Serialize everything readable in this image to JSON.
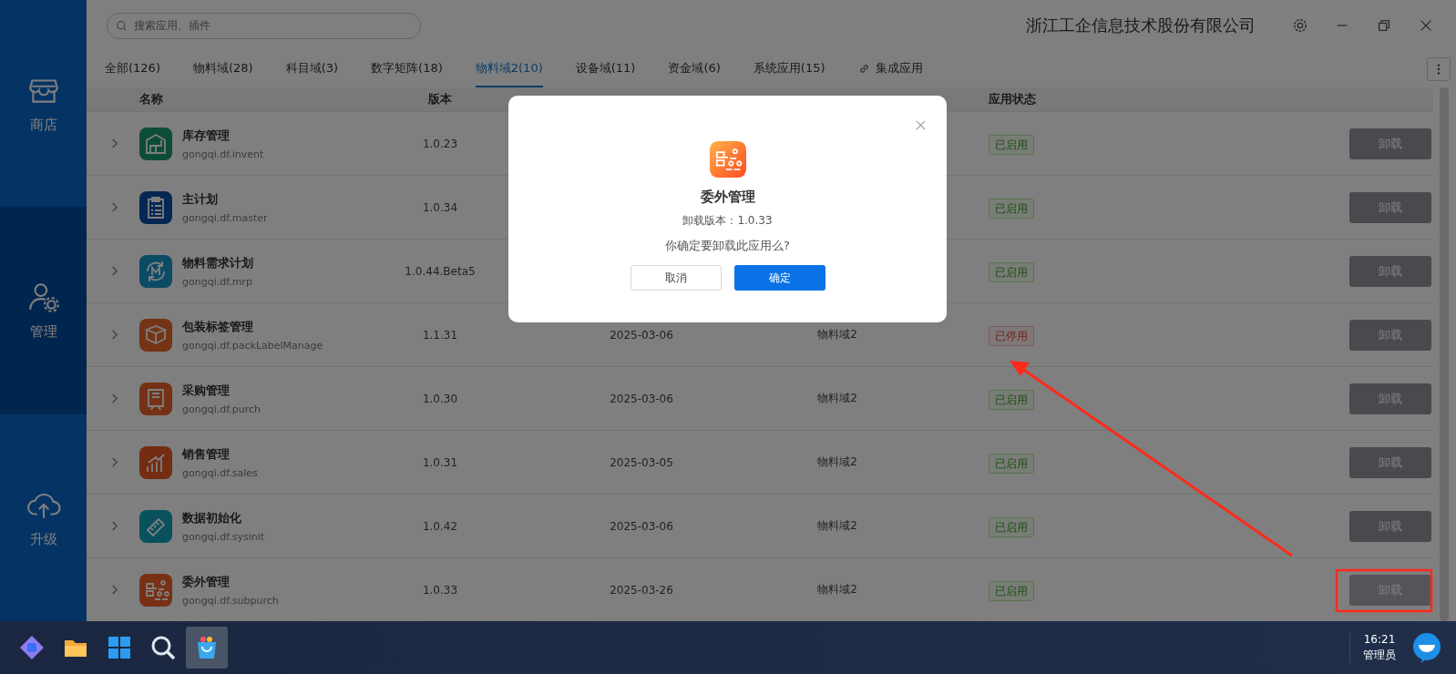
{
  "window": {
    "company": "浙江工企信息技术股份有限公司"
  },
  "search": {
    "placeholder": "搜索应用、插件"
  },
  "sidebar": {
    "items": [
      {
        "label": "商店",
        "selected": false
      },
      {
        "label": "管理",
        "selected": true
      },
      {
        "label": "升级",
        "selected": false
      }
    ]
  },
  "tabs": [
    {
      "label": "全部(126)",
      "selected": false,
      "kind": "tab"
    },
    {
      "label": "物料域(28)",
      "selected": false,
      "kind": "tab"
    },
    {
      "label": "科目域(3)",
      "selected": false,
      "kind": "tab"
    },
    {
      "label": "数字矩阵(18)",
      "selected": false,
      "kind": "tab"
    },
    {
      "label": "物料域2(10)",
      "selected": true,
      "kind": "tab"
    },
    {
      "label": "设备域(11)",
      "selected": false,
      "kind": "tab"
    },
    {
      "label": "资金域(6)",
      "selected": false,
      "kind": "tab"
    },
    {
      "label": "系统应用(15)",
      "selected": false,
      "kind": "tab"
    },
    {
      "label": "集成应用",
      "selected": false,
      "kind": "link"
    }
  ],
  "table": {
    "columns": [
      "名称",
      "版本",
      "应用状态"
    ],
    "rows": [
      {
        "name": "库存管理",
        "id": "gongqi.df.invent",
        "version": "1.0.23",
        "status": "已启用",
        "enabled": true,
        "action": "卸载",
        "highlighted": false
      },
      {
        "name": "主计划",
        "id": "gongqi.df.master",
        "version": "1.0.34",
        "status": "已启用",
        "enabled": true,
        "action": "卸载",
        "highlighted": false
      },
      {
        "name": "物料需求计划",
        "id": "gongqi.df.mrp",
        "version": "1.0.44.Beta5",
        "status": "已启用",
        "enabled": true,
        "action": "卸载",
        "highlighted": false
      },
      {
        "name": "包装标签管理",
        "id": "gongqi.df.packLabelManage",
        "version": "1.1.31",
        "date": "2025-03-06",
        "domain": "物料域2",
        "status": "已停用",
        "enabled": false,
        "action": "卸载",
        "highlighted": false
      },
      {
        "name": "采购管理",
        "id": "gongqi.df.purch",
        "version": "1.0.30",
        "date": "2025-03-06",
        "domain": "物料域2",
        "status": "已启用",
        "enabled": true,
        "action": "卸载",
        "highlighted": false
      },
      {
        "name": "销售管理",
        "id": "gongqi.df.sales",
        "version": "1.0.31",
        "date": "2025-03-05",
        "domain": "物料域2",
        "status": "已启用",
        "enabled": true,
        "action": "卸载",
        "highlighted": false
      },
      {
        "name": "数据初始化",
        "id": "gongqi.df.sysinit",
        "version": "1.0.42",
        "date": "2025-03-06",
        "domain": "物料域2",
        "status": "已启用",
        "enabled": true,
        "action": "卸载",
        "highlighted": false
      },
      {
        "name": "委外管理",
        "id": "gongqi.df.subpurch",
        "version": "1.0.33",
        "date": "2025-03-26",
        "domain": "物料域2",
        "status": "已启用",
        "enabled": true,
        "action": "卸载",
        "highlighted": true
      }
    ]
  },
  "dialog": {
    "title": "委外管理",
    "version": "卸载版本：1.0.33",
    "question": "你确定要卸载此应用么?",
    "buttons": [
      {
        "label": "取消",
        "kind": "secondary"
      },
      {
        "label": "确定",
        "kind": "primary"
      }
    ]
  },
  "taskbar": {
    "items": [
      {
        "selected": false
      },
      {
        "selected": false
      },
      {
        "selected": false
      },
      {
        "selected": false
      },
      {
        "selected": true
      }
    ],
    "time": "16:21",
    "user": "管理员"
  }
}
